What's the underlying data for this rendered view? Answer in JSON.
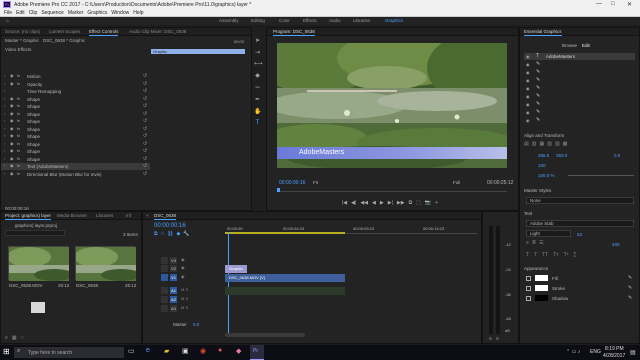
{
  "window": {
    "title": "Adobe Premiere Pro CC 2017 - C:\\Users\\Production\\Documents\\Adobe\\Premiere Pro\\11.0\\graphics) layer *",
    "minimize": "—",
    "maximize": "□",
    "close": "✕"
  },
  "menu": [
    "File",
    "Edit",
    "Clip",
    "Sequence",
    "Marker",
    "Graphics",
    "Window",
    "Help"
  ],
  "workspaces": [
    "Assembly",
    "Editing",
    "Color",
    "Effects",
    "Audio",
    "Libraries",
    "Graphics"
  ],
  "active_workspace": "Graphics",
  "source_panel": {
    "tabs": [
      "Source: (no clips)",
      "Lumetri Scopes",
      "Effect Controls",
      "Audio Clip Mixer: DSC_0638"
    ],
    "active_tab": "Effect Controls",
    "master": "Master * Graphic",
    "seq": "DSC_0638 * Graphic",
    "timecode_top": "00:00",
    "graphic_label": "Graphic",
    "section": "Video Effects",
    "rows": [
      {
        "label": "Motion",
        "fx": true
      },
      {
        "label": "Opacity",
        "fx": true
      },
      {
        "label": "Time Remapping",
        "fx": false
      },
      {
        "label": "Shape",
        "fx": true
      },
      {
        "label": "Shape",
        "fx": true
      },
      {
        "label": "Shape",
        "fx": true
      },
      {
        "label": "Shape",
        "fx": true
      },
      {
        "label": "Shape",
        "fx": true
      },
      {
        "label": "Shape",
        "fx": true
      },
      {
        "label": "Shape",
        "fx": true
      },
      {
        "label": "Shape",
        "fx": true
      },
      {
        "label": "Shape",
        "fx": true
      },
      {
        "label": "Text (AdobeMasters)",
        "fx": true
      },
      {
        "label": "Directional Blur (Motion Blur for Invis)",
        "fx": true
      }
    ],
    "timecode": "00:00:00:16"
  },
  "program": {
    "title": "Program: DSC_0638",
    "overlay_text": "AdobeMasters",
    "timecode_left": "00:00:00:16",
    "fit": "Fit",
    "quality": "Full",
    "timecode_right": "00:00:25:12",
    "controls": [
      "|◀",
      "◀|",
      "◀◀",
      "◀",
      "▶",
      "▶|",
      "▶▶",
      "⧉",
      "⬚",
      "📷",
      "+"
    ]
  },
  "essential_graphics": {
    "title": "Essential Graphics",
    "tabs": [
      "Browse",
      "Edit"
    ],
    "active_tab": "Edit",
    "layers": [
      "AdobeMasters",
      "",
      "",
      "",
      "",
      "",
      "",
      "",
      ""
    ],
    "align_label": "Align and Transform",
    "transform": {
      "x": "256.5",
      "y": "393.0",
      "rot": "0.0",
      "scale": "100",
      "opacity": "100.0 %"
    },
    "master_styles_label": "Master Styles",
    "master_style": "None",
    "text_label": "Text",
    "font": "Adobe Stab",
    "font_style": "Light",
    "font_size": "63",
    "tracking": "400",
    "appearance_label": "Appearance",
    "fill_label": "Fill",
    "stroke_label": "Stroke",
    "shadow_label": "Shadow"
  },
  "project": {
    "tabs": [
      "Project: graphics) layer",
      "Media Browser",
      "Libraries",
      "Inf"
    ],
    "active_tab": "Project: graphics) layer",
    "path": "graphics) layer.prproj",
    "item_count": "3 Items",
    "clips": [
      {
        "name": "DSC_0638.MOV",
        "dur": "25:12"
      },
      {
        "name": "DSC_0638",
        "dur": "25:12"
      }
    ]
  },
  "timeline": {
    "title": "DSC_0638",
    "timecode": "00:00:00:16",
    "ruler": [
      "00:00:00",
      "00:00:04:23",
      "00:00:09:23",
      "00:00:14:23"
    ],
    "tracks": [
      {
        "name": "V3",
        "clip": ""
      },
      {
        "name": "V2",
        "clip": "Graphic"
      },
      {
        "name": "V1",
        "clip": "DSC_0638.MOV [V]"
      },
      {
        "name": "A1",
        "clip": ""
      },
      {
        "name": "A2",
        "clip": ""
      },
      {
        "name": "A3",
        "clip": ""
      }
    ],
    "master_label": "Master",
    "master_val": "0.0"
  },
  "audio_meter": {
    "labels": [
      "-12",
      "-24",
      "-36",
      "-48",
      "dB"
    ],
    "s": "S"
  },
  "taskbar": {
    "search_placeholder": "Type here to search",
    "time": "8:19 PM",
    "date": "4/28/2017",
    "lang": "ENG"
  },
  "colors": {
    "accent": "#4aa0ff",
    "clip_blue": "#3e5f9c",
    "graphic_lilac": "#9a9ad0",
    "panel": "#232323"
  }
}
